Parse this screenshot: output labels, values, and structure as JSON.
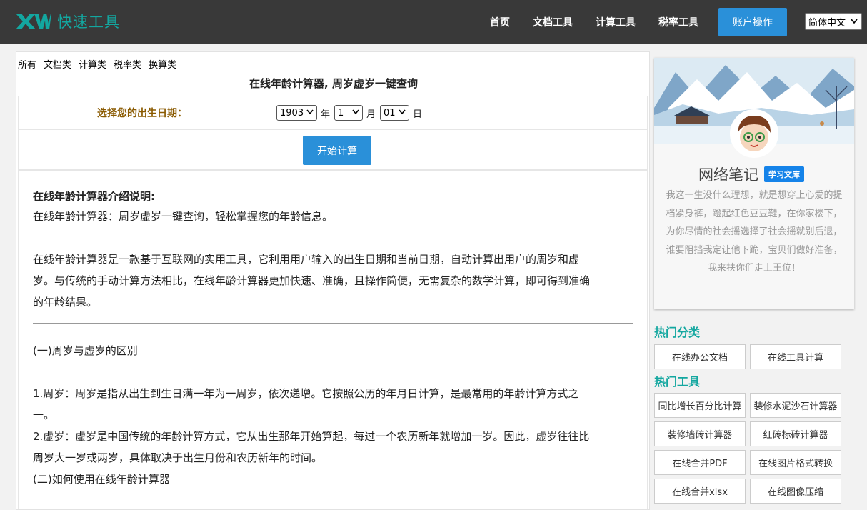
{
  "header": {
    "logo_mark": "XW",
    "logo_text": "快速工具",
    "nav": [
      "首页",
      "文档工具",
      "计算工具",
      "税率工具"
    ],
    "account_label": "账户操作",
    "language": "简体中文"
  },
  "categories": [
    "所有",
    "文档类",
    "计算类",
    "税率类",
    "换算类"
  ],
  "page_title": "在线年龄计算器, 周岁虚岁一键查询",
  "form": {
    "label": "选择您的出生日期：",
    "year": "1903",
    "year_unit": "年",
    "month": "1",
    "month_unit": "月",
    "day": "01",
    "day_unit": "日",
    "submit_label": "开始计算"
  },
  "article": {
    "heading": "在线年龄计算器介绍说明:",
    "intro": "在线年龄计算器：周岁虚岁一键查询，轻松掌握您的年龄信息。",
    "para1_line1": "在线年龄计算器是一款基于互联网的实用工具，它利用用户输入的出生日期和当前日期，自动计算出用户的周岁和虚",
    "para1_line2": "岁。与传统的手动计算方法相比，在线年龄计算器更加快速、准确，且操作简便，无需复杂的数学计算，即可得到准确",
    "para1_line3": "的年龄结果。",
    "section1": "(一)周岁与虚岁的区别",
    "item1_line1": "1.周岁：周岁是指从出生到生日满一年为一周岁，依次递增。它按照公历的年月日计算，是最常用的年龄计算方式之",
    "item1_line2": "一。",
    "item2_line1": "2.虚岁：虚岁是中国传统的年龄计算方式，它从出生那年开始算起，每过一个农历新年就增加一岁。因此，虚岁往往比",
    "item2_line2": "周岁大一岁或两岁，具体取决于出生月份和农历新年的时间。",
    "section2": "(二)如何使用在线年龄计算器"
  },
  "profile": {
    "name": "网络笔记",
    "badge": "学习文库",
    "bio": "我这一生没什么理想，就是想穿上心爱的提档紧身裤，蹬起红色豆豆鞋，在你家楼下，为你尽情的社会摇选择了社会摇就别后退，谁要阻挡我定让他下跪，宝贝们做好准备，我来扶你们走上王位！"
  },
  "hot_categories": {
    "title": "热门分类",
    "items": [
      "在线办公文档",
      "在线工具计算"
    ]
  },
  "hot_tools": {
    "title": "热门工具",
    "items": [
      "同比增长百分比计算",
      "装修水泥沙石计算器",
      "装修墙砖计算器",
      "红砖标砖计算器",
      "在线合并PDF",
      "在线图片格式转换",
      "在线合并xlsx",
      "在线图像压缩"
    ]
  },
  "colors": {
    "topbar": "#393939",
    "accent_blue": "#2a90d9",
    "teal": "#13a7a0",
    "label_brown": "#8a5a00"
  }
}
